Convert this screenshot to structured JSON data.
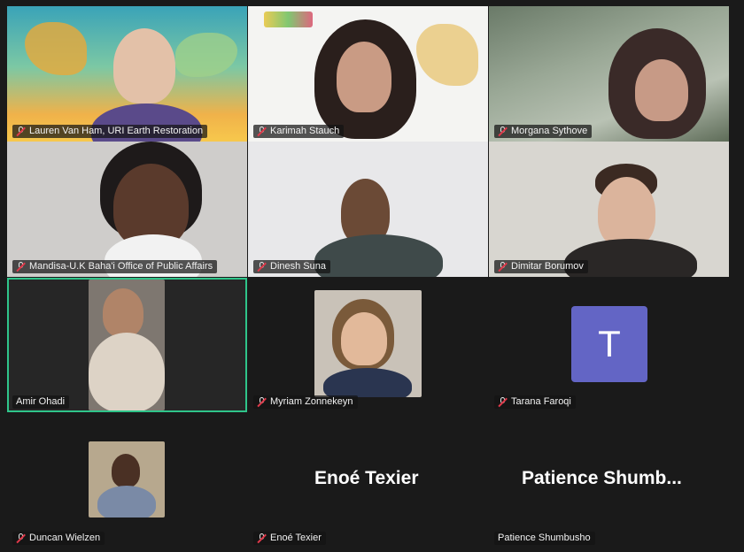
{
  "participants": [
    {
      "name": "Lauren Van Ham, URI Earth Restoration",
      "muted": true
    },
    {
      "name": "Karimah Stauch",
      "muted": true
    },
    {
      "name": "Morgana Sythove",
      "muted": true
    },
    {
      "name": "Mandisa-U.K Baha'i Office of Public Affairs",
      "muted": true
    },
    {
      "name": "Dinesh Suna",
      "muted": true
    },
    {
      "name": "Dimitar Borumov",
      "muted": true
    },
    {
      "name": "Amir Ohadi",
      "muted": false,
      "active_speaker": true
    },
    {
      "name": "Myriam Zonnekeyn",
      "muted": true
    },
    {
      "name": "Tarana Faroqi",
      "muted": true,
      "avatar_letter": "T"
    },
    {
      "name": "Duncan Wielzen",
      "muted": true
    },
    {
      "name": "Enoé Texier",
      "muted": true,
      "display_title": "Enoé Texier"
    },
    {
      "name": "Patience Shumbusho",
      "muted": false,
      "display_title": "Patience  Shumb..."
    }
  ],
  "icons": {
    "muted": "mic-muted-icon"
  },
  "colors": {
    "active_border": "#2fc58a",
    "avatar_bg": "#6365c5",
    "mute_slash": "#e0394a"
  }
}
